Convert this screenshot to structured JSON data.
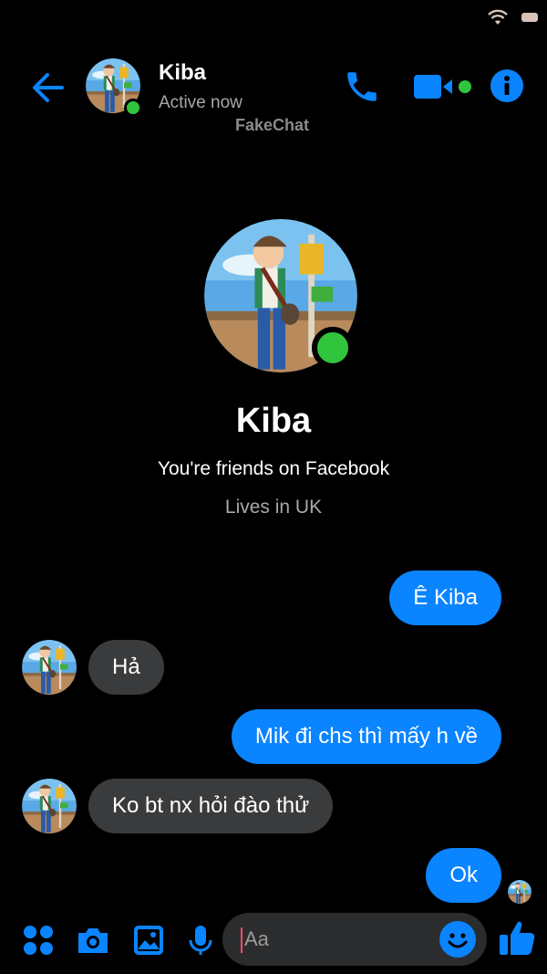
{
  "header": {
    "contact_name": "Kiba",
    "status": "Active now",
    "watermark": "FakeChat"
  },
  "profile": {
    "name": "Kiba",
    "friends_text": "You're friends on Facebook",
    "location_text": "Lives in UK"
  },
  "messages": [
    {
      "direction": "sent",
      "text": "Ê Kiba"
    },
    {
      "direction": "received",
      "text": "Hả"
    },
    {
      "direction": "sent",
      "text": "Mik đi chs thì mấy h về"
    },
    {
      "direction": "received",
      "text": "Ko bt nx hỏi đào thử"
    },
    {
      "direction": "sent",
      "text": "Ok"
    }
  ],
  "composer": {
    "placeholder": "Aa",
    "tools": [
      "apps-icon",
      "camera-icon",
      "gallery-icon",
      "microphone-icon"
    ]
  },
  "colors": {
    "accent": "#0a84ff",
    "online": "#31c53e",
    "received_bubble": "#3a3b3c",
    "background": "#000000"
  }
}
